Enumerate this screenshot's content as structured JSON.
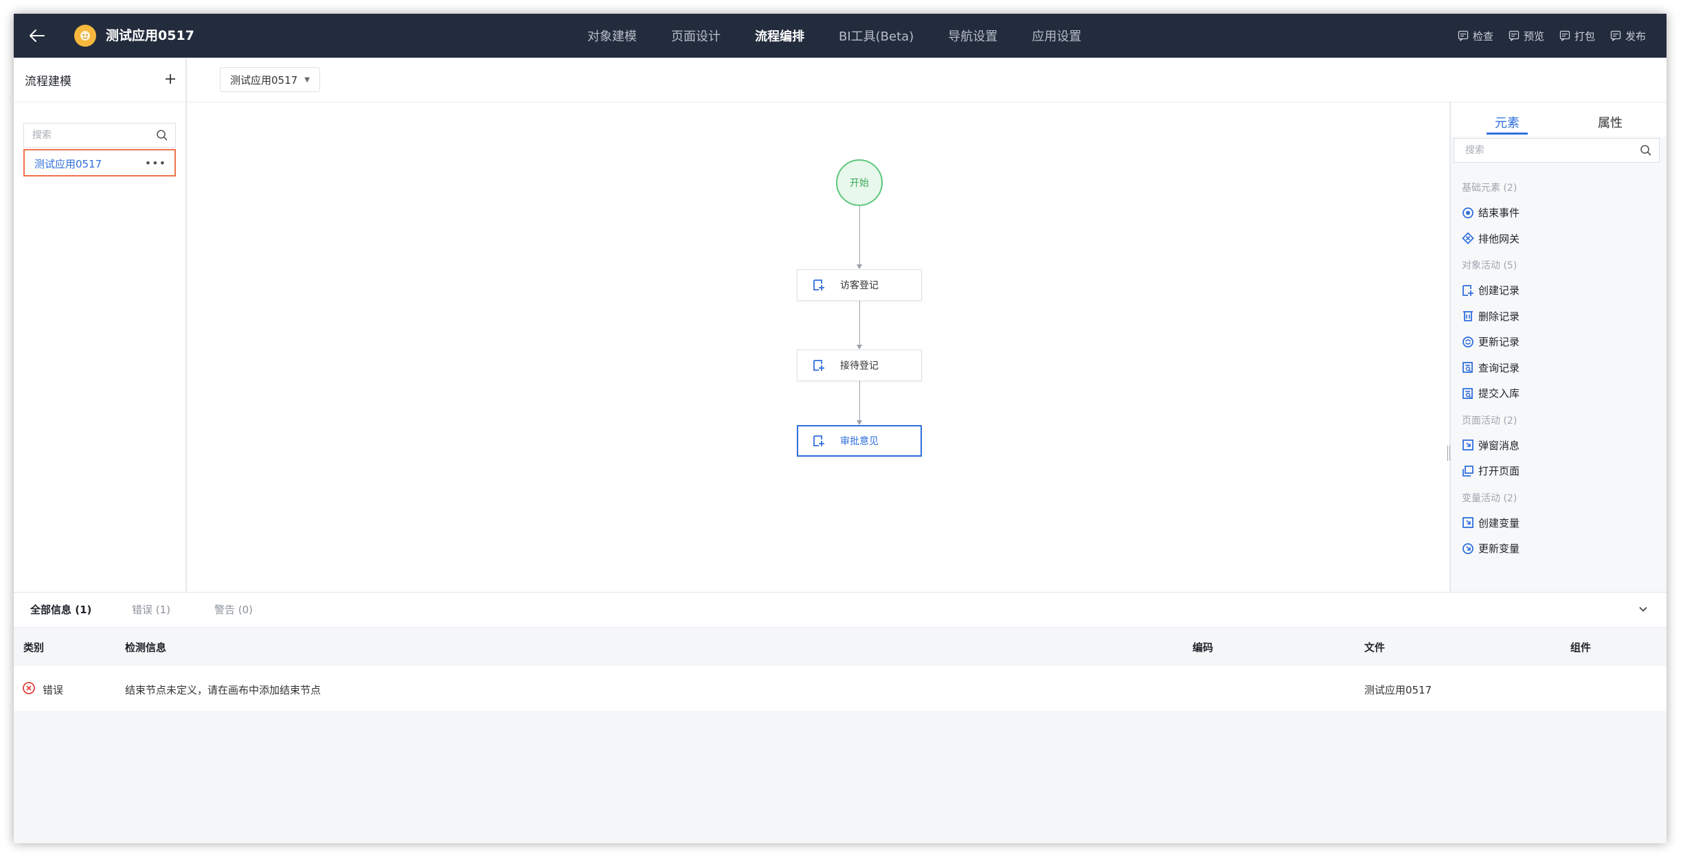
{
  "header": {
    "app_title": "测试应用0517",
    "nav": [
      {
        "label": "对象建模",
        "active": false
      },
      {
        "label": "页面设计",
        "active": false
      },
      {
        "label": "流程编排",
        "active": true
      },
      {
        "label": "BI工具(Beta)",
        "active": false
      },
      {
        "label": "导航设置",
        "active": false
      },
      {
        "label": "应用设置",
        "active": false
      }
    ],
    "actions": [
      "检查",
      "预览",
      "打包",
      "发布"
    ]
  },
  "left_panel": {
    "title": "流程建模",
    "search_placeholder": "搜索",
    "items": [
      "测试应用0517"
    ]
  },
  "toolbar": {
    "selected_flow": "测试应用0517"
  },
  "canvas": {
    "start_label": "开始",
    "tasks": [
      "访客登记",
      "接待登记",
      "审批意见"
    ],
    "selected_task": "审批意见"
  },
  "right_panel": {
    "tabs": [
      "元素",
      "属性"
    ],
    "active_tab": "元素",
    "search_placeholder": "搜索",
    "groups": [
      {
        "title": "基础元素 (2)",
        "items": [
          "结束事件",
          "排他网关"
        ]
      },
      {
        "title": "对象活动 (5)",
        "items": [
          "创建记录",
          "删除记录",
          "更新记录",
          "查询记录",
          "提交入库"
        ]
      },
      {
        "title": "页面活动 (2)",
        "items": [
          "弹窗消息",
          "打开页面"
        ]
      },
      {
        "title": "变量活动 (2)",
        "items": [
          "创建变量",
          "更新变量"
        ]
      }
    ]
  },
  "bottom_panel": {
    "tabs": [
      "全部信息 (1)",
      "错误 (1)",
      "警告 (0)"
    ],
    "active_tab": "全部信息 (1)",
    "columns": [
      "类别",
      "检测信息",
      "编码",
      "文件",
      "组件"
    ],
    "rows": [
      {
        "category": "错误",
        "message": "结束节点未定义，请在画布中添加结束节点",
        "code": "",
        "file": "测试应用0517",
        "component": ""
      }
    ]
  },
  "colors": {
    "topbar": "#232c3d",
    "accent": "#2f6fdc",
    "selection": "#f0714a",
    "start_node": "#5cc77c",
    "error": "#e2403a"
  }
}
